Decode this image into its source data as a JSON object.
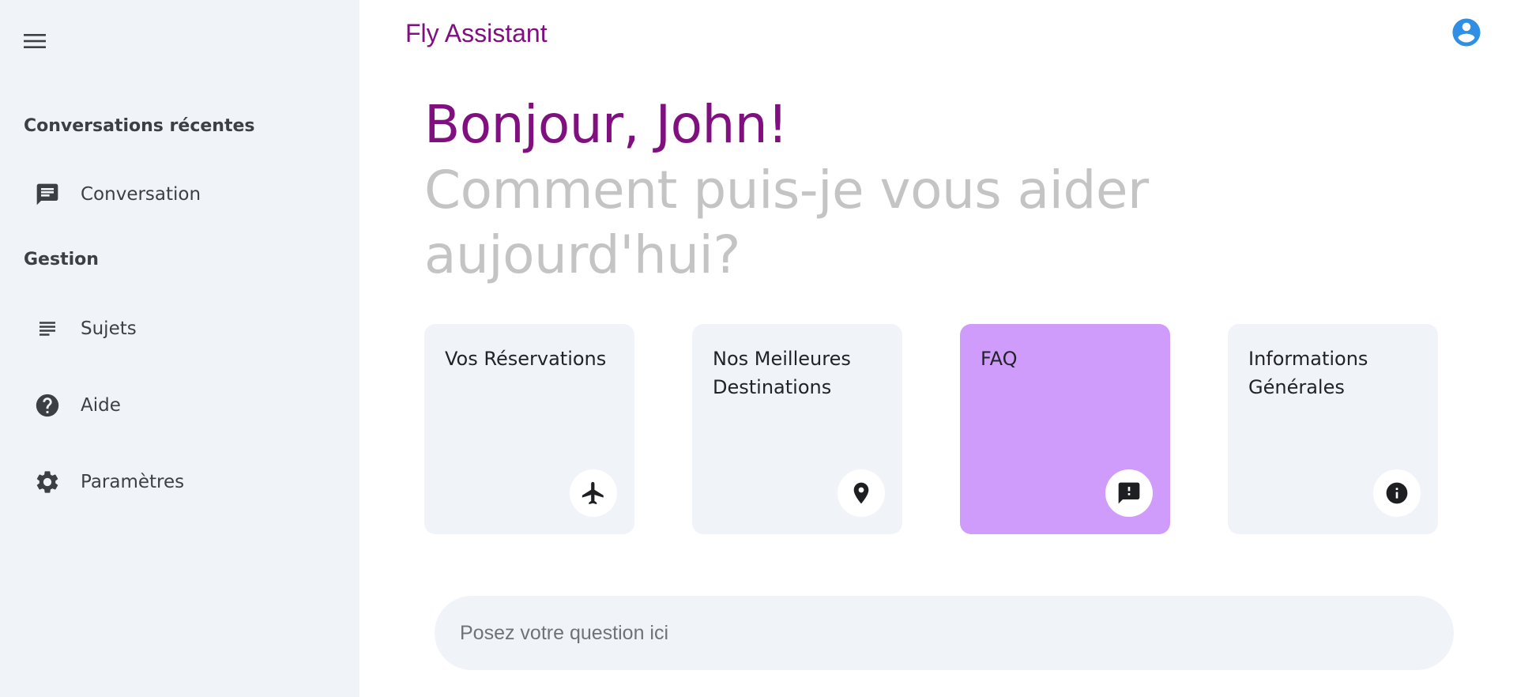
{
  "app": {
    "title": "Fly Assistant"
  },
  "sidebar": {
    "sections": [
      {
        "title": "Conversations récentes"
      },
      {
        "title": "Gestion"
      }
    ],
    "recent": [
      {
        "label": "Conversation",
        "icon": "chat-icon"
      }
    ],
    "manage": [
      {
        "label": "Sujets",
        "icon": "subject-lines-icon"
      },
      {
        "label": "Aide",
        "icon": "help-icon"
      },
      {
        "label": "Paramètres",
        "icon": "gear-icon"
      }
    ]
  },
  "main": {
    "greeting": "Bonjour, John!",
    "subtitle": "Comment puis-je vous aider aujourd'hui?",
    "cards": [
      {
        "label": "Vos Réservations",
        "icon": "airplane-icon"
      },
      {
        "label": "Nos Meilleures Destinations",
        "icon": "location-pin-icon"
      },
      {
        "label": "FAQ",
        "icon": "feedback-icon",
        "active": true
      },
      {
        "label": "Informations Générales",
        "icon": "info-icon"
      }
    ],
    "search": {
      "placeholder": "Posez votre question ici"
    }
  },
  "colors": {
    "brand": "#800f80",
    "sidebar_bg": "#f0f3f8",
    "card_active": "#cf9cfc",
    "avatar": "#2f8fe4",
    "subtitle": "#c4c4c4"
  }
}
